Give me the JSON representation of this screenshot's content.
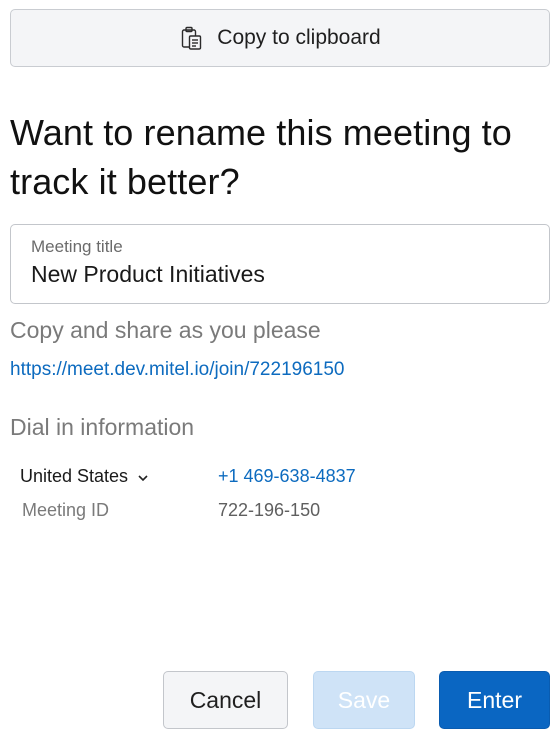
{
  "copy_button": {
    "label": "Copy to clipboard",
    "icon": "clipboard-icon"
  },
  "heading": "Want to rename this meeting to track it better?",
  "meeting_title": {
    "label": "Meeting title",
    "value": "New Product Initiatives"
  },
  "share": {
    "heading": "Copy and share as you please",
    "link": "https://meet.dev.mitel.io/join/722196150"
  },
  "dial_in": {
    "heading": "Dial in information",
    "country": "United States",
    "phone": "+1 469-638-4837",
    "meeting_id_label": "Meeting ID",
    "meeting_id_value": "722-196-150"
  },
  "buttons": {
    "cancel": "Cancel",
    "save": "Save",
    "enter": "Enter"
  },
  "colors": {
    "accent": "#0a66c2",
    "link": "#0d6bbf",
    "save_disabled": "#cfe3f7"
  }
}
